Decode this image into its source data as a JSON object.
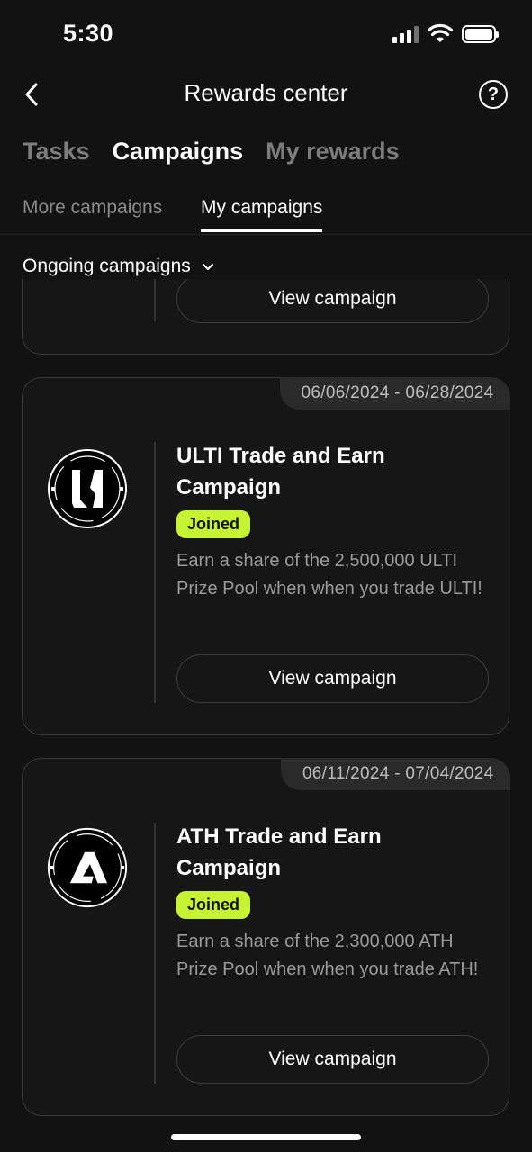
{
  "status_bar": {
    "time": "5:30"
  },
  "header": {
    "title": "Rewards center",
    "help_label": "?"
  },
  "main_tabs": [
    {
      "label": "Tasks"
    },
    {
      "label": "Campaigns"
    },
    {
      "label": "My rewards"
    }
  ],
  "sub_tabs": [
    {
      "label": "More campaigns"
    },
    {
      "label": "My campaigns"
    }
  ],
  "filter": {
    "label": "Ongoing campaigns"
  },
  "campaigns": [
    {
      "view_label": "View campaign"
    },
    {
      "date_range": "06/06/2024 - 06/28/2024",
      "logo_icon": "ulti-logo-icon",
      "title": "ULTI Trade and Earn Campaign",
      "badge": "Joined",
      "description": "Earn a share of the 2,500,000 ULTI Prize Pool when when you trade ULTI!",
      "view_label": "View campaign"
    },
    {
      "date_range": "06/11/2024 - 07/04/2024",
      "logo_icon": "ath-logo-icon",
      "title": "ATH Trade and Earn Campaign",
      "badge": "Joined",
      "description": "Earn a share of the 2,300,000 ATH Prize Pool when when you trade ATH!",
      "view_label": "View campaign"
    }
  ],
  "colors": {
    "accent": "#c6f432",
    "background": "#121212"
  }
}
